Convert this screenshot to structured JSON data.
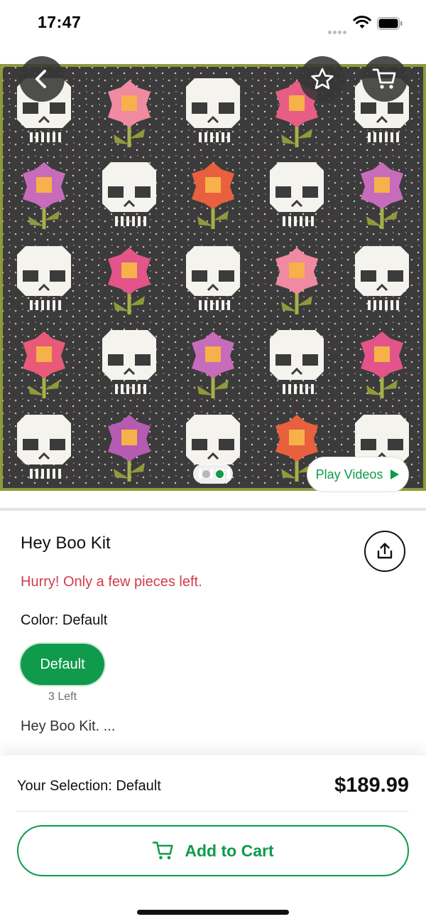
{
  "status_bar": {
    "time": "17:47"
  },
  "hero": {
    "play_videos_label": "Play Videos",
    "page_count": 2,
    "active_page": 2
  },
  "product": {
    "title": "Hey Boo Kit",
    "stock_message": "Hurry! Only a few pieces left.",
    "color_label": "Color:",
    "color_value": "Default",
    "variant": {
      "label": "Default",
      "stock": "3 Left"
    },
    "description": "Hey Boo Kit. ..."
  },
  "footer": {
    "selection_label": "Your Selection:",
    "selection_value": "Default",
    "price": "$189.99",
    "add_to_cart_label": "Add to Cart"
  },
  "icons": {
    "back": "chevron-left-icon",
    "favorite": "star-outline-icon",
    "cart": "cart-icon",
    "share": "share-upload-icon",
    "play": "play-triangle-icon"
  },
  "colors": {
    "brand_green": "#0f9b4b",
    "alert_red": "#d23b4d",
    "quilt_background": "#3b3b3b"
  }
}
